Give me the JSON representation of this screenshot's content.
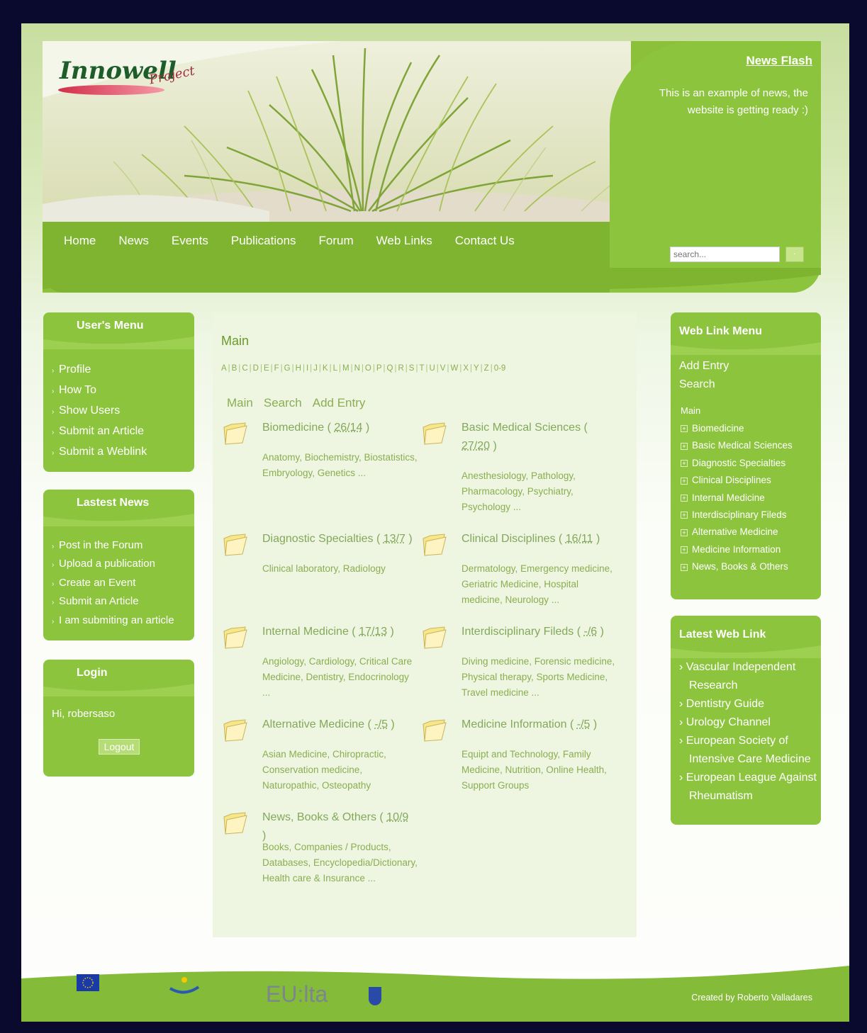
{
  "brand": {
    "name": "Innowell",
    "sub": "Project"
  },
  "newsflash": {
    "title": "News Flash",
    "text": "This is an example of news, the website is getting ready :)"
  },
  "search": {
    "placeholder": "search...",
    "button": "·"
  },
  "nav": [
    "Home",
    "News",
    "Events",
    "Publications",
    "Forum",
    "Web Links",
    "Contact Us"
  ],
  "users_menu": {
    "title": "User's Menu",
    "items": [
      "Profile",
      "How To",
      "Show Users",
      "Submit an Article",
      "Submit a Weblink"
    ]
  },
  "latest_news": {
    "title": "Lastest News",
    "items": [
      "Post in the Forum",
      "Upload a publication",
      "Create an Event",
      "Submit an Article",
      "I am submiting an article"
    ]
  },
  "login": {
    "title": "Login",
    "greeting": "Hi, robersaso",
    "button": "Logout"
  },
  "main": {
    "title": "Main",
    "alphabet": [
      "A",
      "B",
      "C",
      "D",
      "E",
      "F",
      "G",
      "H",
      "I",
      "J",
      "K",
      "L",
      "M",
      "N",
      "O",
      "P",
      "Q",
      "R",
      "S",
      "T",
      "U",
      "V",
      "W",
      "X",
      "Y",
      "Z",
      "0-9"
    ],
    "tabs": [
      "Main",
      "Search",
      "Add Entry"
    ],
    "categories": [
      {
        "name": "Biomedicine",
        "count": "26/14",
        "subs": "Anatomy, Biochemistry, Biostatistics, Embryology, Genetics ..."
      },
      {
        "name": "Basic Medical Sciences",
        "count": "27/20",
        "subs": "Anesthesiology, Pathology, Pharmacology, Psychiatry, Psychology ..."
      },
      {
        "name": "Diagnostic Specialties",
        "count": "13/7",
        "subs": "Clinical laboratory, Radiology"
      },
      {
        "name": "Clinical Disciplines",
        "count": "16/11",
        "subs": "Dermatology, Emergency medicine, Geriatric Medicine, Hospital medicine, Neurology ..."
      },
      {
        "name": "Internal Medicine",
        "count": "17/13",
        "subs": "Angiology, Cardiology, Critical Care Medicine, Dentistry, Endocrinology ..."
      },
      {
        "name": "Interdisciplinary Fileds",
        "count": "-/6",
        "subs": "Diving medicine, Forensic medicine, Physical therapy, Sports Medicine, Travel medicine ..."
      },
      {
        "name": "Alternative Medicine",
        "count": "-/5",
        "subs": "Asian Medicine, Chiropractic, Conservation medicine, Naturopathic, Osteopathy"
      },
      {
        "name": "Medicine Information",
        "count": "-/5",
        "subs": "Equipt and Technology, Family Medicine, Nutrition, Online Health, Support Groups"
      },
      {
        "name": "News, Books & Others",
        "count": "10/9",
        "subs": "Books, Companies / Products, Databases, Encyclopedia/Dictionary, Health care & Insurance ..."
      }
    ]
  },
  "weblink_menu": {
    "title": "Web Link Menu",
    "links": [
      "Add Entry",
      "Search"
    ],
    "tree_label": "Main",
    "tree": [
      "Biomedicine",
      "Basic Medical Sciences",
      "Diagnostic Specialties",
      "Clinical Disciplines",
      "Internal Medicine",
      "Interdisciplinary Fileds",
      "Alternative Medicine",
      "Medicine Information",
      "News, Books & Others"
    ]
  },
  "latest_weblink": {
    "title": "Latest Web Link",
    "items": [
      "Vascular Independent Research",
      "Dentistry Guide",
      "Urology Channel",
      "European Society of Intensive Care Medicine",
      "European League Against Rheumatism"
    ]
  },
  "footer": {
    "eu": "EU:lta",
    "credit": "Created by Roberto Valladares"
  }
}
